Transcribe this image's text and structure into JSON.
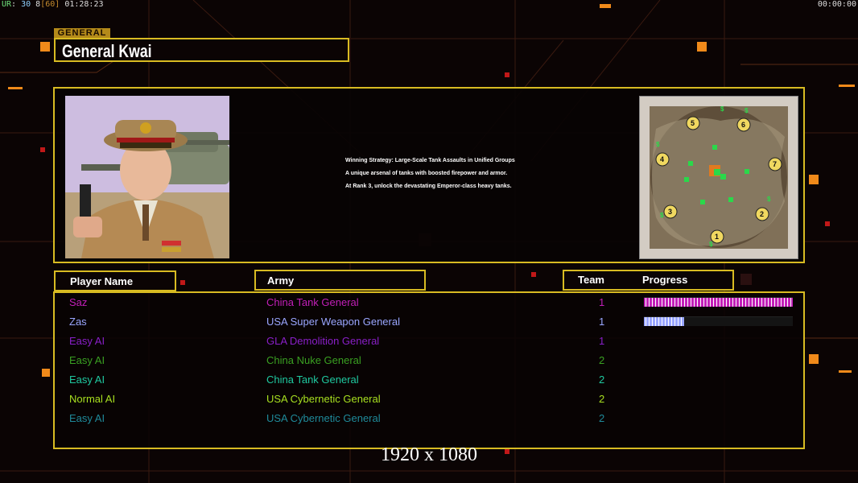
{
  "hud": {
    "ur": "UR",
    "fps": "30",
    "fps_target": "8",
    "fps_cap": "[60]",
    "clock": "01:28:23",
    "timer": "00:00:00"
  },
  "general": {
    "tag": "GENERAL",
    "name": "General Kwai",
    "portrait_icon": "general-portrait",
    "description": [
      "Winning Strategy: Large-Scale Tank Assaults in Unified Groups",
      "A unique arsenal of tanks with boosted firepower and armor.",
      "At Rank 3, unlock the devastating Emperor-class heavy tanks."
    ]
  },
  "minimap": {
    "icon": "map-preview",
    "start_positions": [
      "1",
      "2",
      "3",
      "4",
      "5",
      "6",
      "7"
    ],
    "supply_marker": "$"
  },
  "columns": {
    "player_name": "Player Name",
    "army": "Army",
    "team": "Team",
    "progress": "Progress"
  },
  "players": [
    {
      "name": "Saz",
      "army": "China Tank General",
      "team": "1",
      "color": "#c21fb8",
      "progress": 1.0
    },
    {
      "name": "Zas",
      "army": "USA Super Weapon General",
      "team": "1",
      "color": "#9aa6ff",
      "progress": 0.27
    },
    {
      "name": "Easy AI",
      "army": "GLA Demolition General",
      "team": "1",
      "color": "#8a1fc9",
      "progress": null
    },
    {
      "name": "Easy AI",
      "army": "China Nuke General",
      "team": "2",
      "color": "#3aa022",
      "progress": null
    },
    {
      "name": "Easy AI",
      "army": "China Tank General",
      "team": "2",
      "color": "#1fc9a0",
      "progress": null
    },
    {
      "name": "Normal AI",
      "army": "USA Cybernetic General",
      "team": "2",
      "color": "#a8e020",
      "progress": null
    },
    {
      "name": "Easy AI",
      "army": "USA Cybernetic General",
      "team": "2",
      "color": "#1f8a9a",
      "progress": null
    }
  ],
  "resolution_label": "1920 x 1080"
}
